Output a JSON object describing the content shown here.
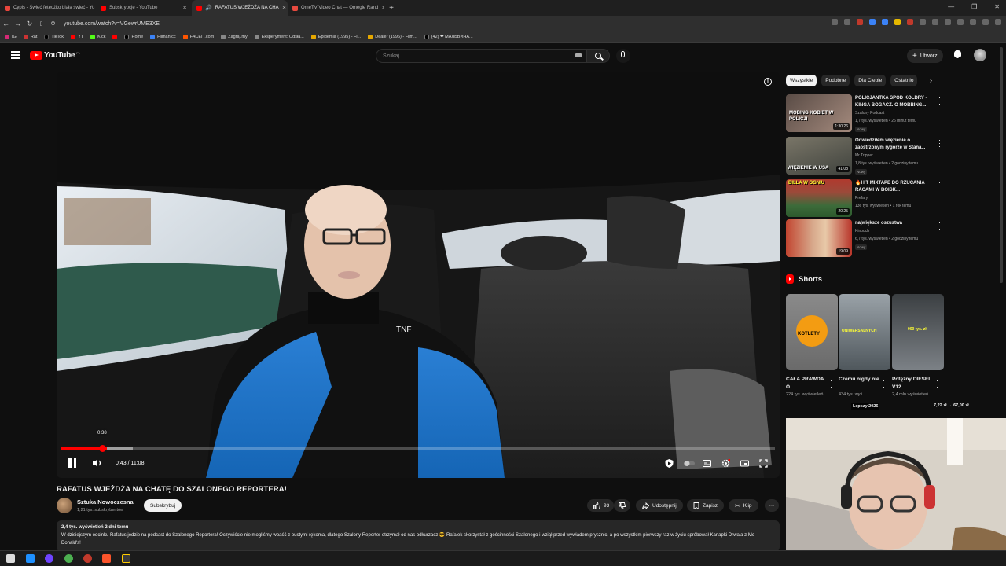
{
  "browser": {
    "tabs": [
      {
        "title": "Cypis - Świeć fetecźko biała świeć - Yo",
        "color": "#e8453c"
      },
      {
        "title": "Subskrypcje - YouTube",
        "color": "#ff0000"
      },
      {
        "title": "RAFATUS WJEŻDŻA NA CHA",
        "color": "#ff0000",
        "active": true
      },
      {
        "title": "OmeTV Video Chat — Omegle Rand",
        "color": "#e84a3f"
      }
    ],
    "url": "youtube.com/watch?v=VGewrUME3XE",
    "bookmarks": [
      "IG",
      "Rat",
      "TikTok",
      "YT",
      "Kick",
      "",
      "Home",
      "Filman.cc",
      "FACEIT.com",
      "Zagraj.my",
      "Eksperyment: Odsła...",
      "Epidemia (1995) - Fi...",
      "Dealer (1996) - Film...",
      "(42) ❤ МАЛЬВИНА..."
    ]
  },
  "header": {
    "logo_text": "YouTube",
    "country": "PL",
    "search_placeholder": "Szukaj",
    "create_label": "Utwórz"
  },
  "player": {
    "scrub_time": "0:38",
    "time_display": "0:43 / 11:08",
    "progress_played": 0.064,
    "progress_buffered": 0.1,
    "hover_position": 0.058
  },
  "video": {
    "title": "RAFATUS WJEŻDŻA NA CHATĘ DO SZALONEGO REPORTERA!",
    "channel": "Sztuka Nowoczesna",
    "subscribers": "1,21 tys. subskrybentów",
    "subscribe_label": "Subskrybuj",
    "likes": "93",
    "share_label": "Udostępnij",
    "save_label": "Zapisz",
    "clip_label": "Klip",
    "meta": "2,4 tys. wyświetleń  2 dni temu",
    "description": "W dzisiejszym odcinku Rafatus jedzie na podcast do Szalonego Reportera! Oczywiście nie mogliśmy wpaść z pustymi rękoma, dlatego Szalony Reporter otrzymał od nas odkurzacz 😎 Rafałek skorzystał z gościnności Szalonego i wziął przed wywiadem prysznic, a po wszystkim pierwszy raz w życiu spróbował Kanapki Drwala z Mc Donald's!"
  },
  "sidebar": {
    "chips": [
      "Wszystkie",
      "Podobne",
      "Dla Ciebie",
      "Ostatnio"
    ],
    "recommendations": [
      {
        "title": "POLICJANTKA SPOD KOŁDRY - KINGA BOGACZ. O MOBBING...",
        "channel": "Szalony Podcast",
        "stats": "1,7 tys. wyświetleń • 26 minut temu",
        "badge": "Nowy",
        "duration": "1:30:26",
        "thumb_text": "MOBING KOBIET W POLICJI"
      },
      {
        "title": "Odwiedziłem więzienie o zaostrzonym rygorze w Stana...",
        "channel": "Mr Tripper",
        "stats": "1,8 tys. wyświetleń • 2 godziny temu",
        "badge": "Nowy",
        "duration": "41:08",
        "thumb_text": "WIĘZIENIE W USA"
      },
      {
        "title": "🔥HIT MIXTAPE DO RZUCANIA RACAMI W BOISK...",
        "channel": "Prefary",
        "stats": "136 tys. wyświetleń • 1 rok temu",
        "badge": "",
        "duration": "20:25",
        "thumb_text": "BILLA W OGNIU"
      },
      {
        "title": "największe oszustwa",
        "channel": "Kinouch",
        "stats": "6,7 tys. wyświetleń • 2 godziny temu",
        "badge": "Nowy",
        "duration": "19:09",
        "thumb_text": ""
      }
    ],
    "shorts_heading": "Shorts",
    "shorts": [
      {
        "title": "CAŁA PRAWDA O...",
        "views": "224 tys. wyświetleń",
        "thumb_text": "KOTLETY"
      },
      {
        "title": "Czemu nigdy nie ...",
        "views": "434 tys. wyś",
        "thumb_text": "UNIWERSALNYCH"
      },
      {
        "title": "Potężny DIESEL V12...",
        "views": "2,4 mln wyświetleń",
        "thumb_text": "900 tys. zł"
      }
    ],
    "overlay_left": "Lepszy 2026",
    "overlay_right": "7,22 zł → 67,00 zł"
  },
  "colors": {
    "accent": "#ff0000",
    "background": "#0f0f0f"
  }
}
